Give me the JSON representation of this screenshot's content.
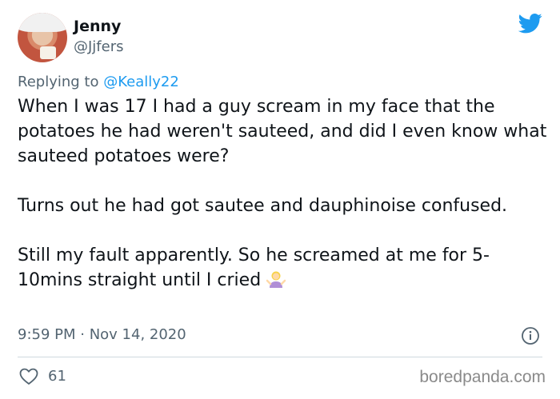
{
  "tweet": {
    "author_name": "Jenny",
    "author_handle": "@Jjfers",
    "reply_prefix": "Replying to",
    "reply_to": "@Keally22",
    "paragraphs": [
      "When I was 17 I had a guy scream in my face that the potatoes he had weren't sauteed, and did I even know what sauteed potatoes were?",
      "Turns out he had got sautee and dauphinoise confused.",
      "Still my fault apparently. So he screamed at me for 5-10mins straight until I cried"
    ],
    "timestamp": "9:59 PM · Nov 14, 2020",
    "likes": "61"
  },
  "watermark": "boredpanda.com",
  "icons": {
    "brand": "twitter-bird-icon",
    "info": "info-icon",
    "like": "heart-icon",
    "emoji": "woman-shrugging-emoji"
  },
  "colors": {
    "accent": "#1d9bf0",
    "secondary_text": "#536471",
    "text": "#0f1419"
  }
}
